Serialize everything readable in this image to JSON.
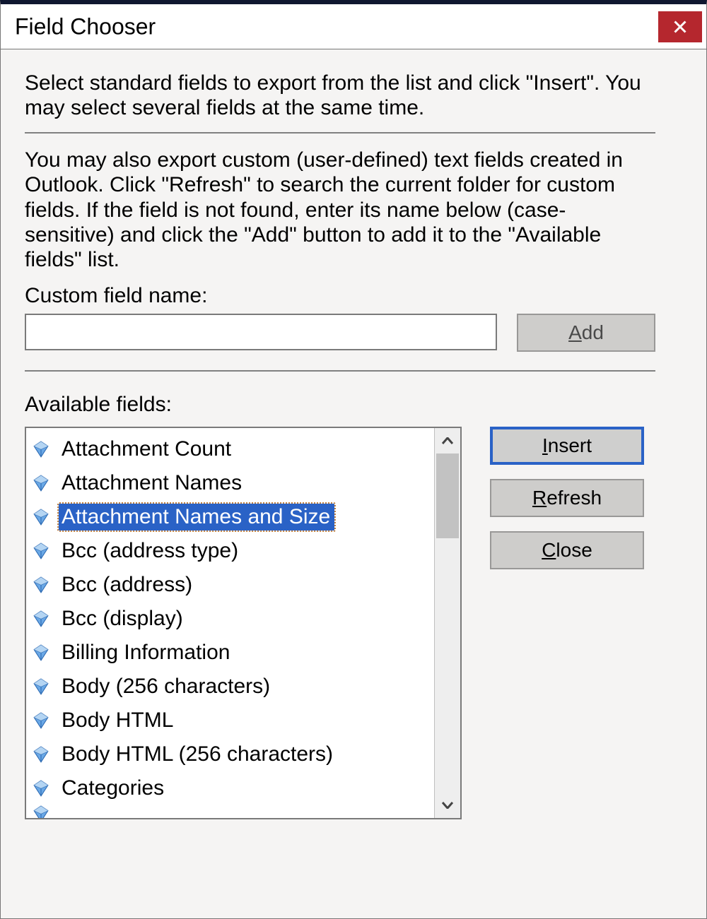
{
  "dialog": {
    "title": "Field Chooser",
    "close_icon": "close-icon"
  },
  "instructions": {
    "primary": "Select standard fields to export from the list and click \"Insert\". You may select several fields at the same time.",
    "secondary": "You may also export custom (user-defined) text fields created in Outlook. Click \"Refresh\" to search the current folder for custom fields. If the field is not found, enter its name below (case-sensitive) and click the \"Add\" button to add it to the \"Available fields\" list."
  },
  "custom": {
    "label": "Custom field name:",
    "value": "",
    "add_pre": "",
    "add_acc": "A",
    "add_post": "dd"
  },
  "available": {
    "label": "Available fields:",
    "selected_index": 2,
    "items": [
      "Attachment Count",
      "Attachment Names",
      "Attachment Names and Size",
      "Bcc (address type)",
      "Bcc (address)",
      "Bcc (display)",
      "Billing Information",
      "Body (256 characters)",
      "Body HTML",
      "Body HTML (256 characters)",
      "Categories"
    ]
  },
  "buttons": {
    "insert_pre": "",
    "insert_acc": "I",
    "insert_post": "nsert",
    "refresh_pre": "",
    "refresh_acc": "R",
    "refresh_post": "efresh",
    "close_pre": "",
    "close_acc": "C",
    "close_post": "lose"
  }
}
